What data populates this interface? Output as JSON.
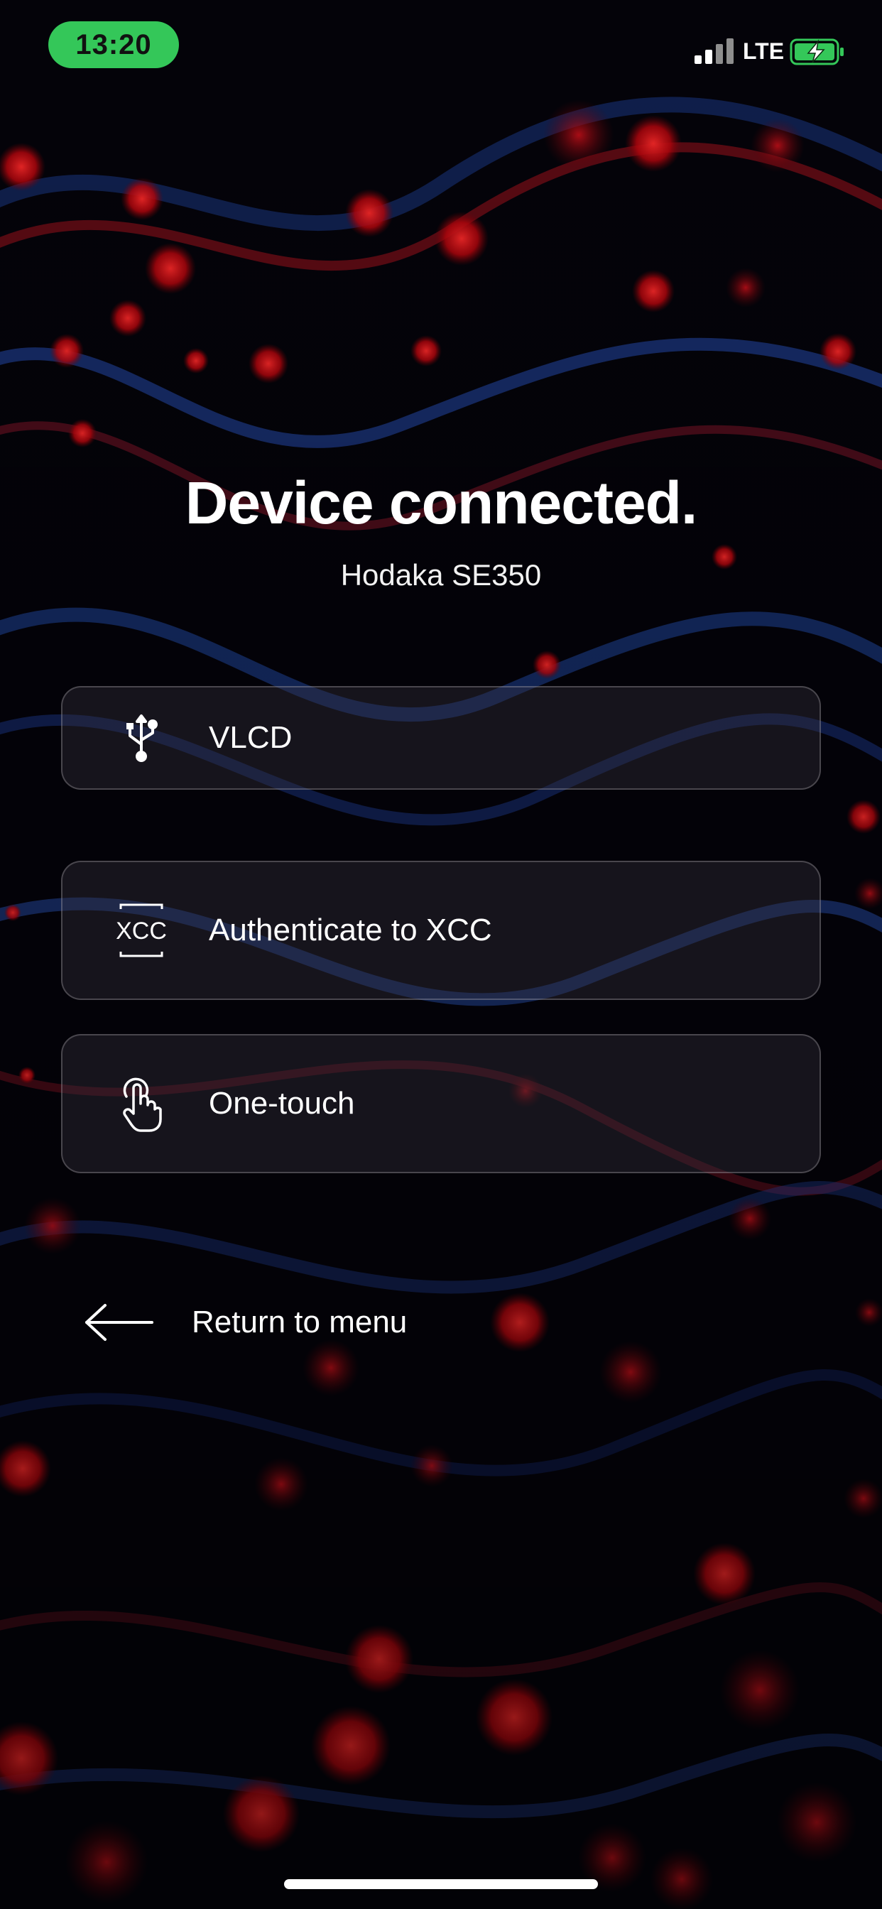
{
  "status_bar": {
    "time": "13:20",
    "network": "LTE",
    "signal_icon": "cellular-signal-icon",
    "battery_icon": "battery-charging-icon",
    "time_pill_color": "#34c759",
    "battery_color": "#34c759"
  },
  "header": {
    "title": "Device connected.",
    "subtitle": "Hodaka SE350"
  },
  "options": [
    {
      "label": "VLCD",
      "icon": "usb-icon"
    },
    {
      "label": "Authenticate to XCC",
      "icon": "xcc-icon",
      "icon_text": "XCC"
    },
    {
      "label": "One-touch",
      "icon": "touch-icon"
    }
  ],
  "return": {
    "label": "Return to menu",
    "icon": "arrow-left-icon"
  },
  "colors": {
    "accent_red": "#e0101a",
    "accent_blue": "#2a5fd8",
    "background": "#030208"
  }
}
